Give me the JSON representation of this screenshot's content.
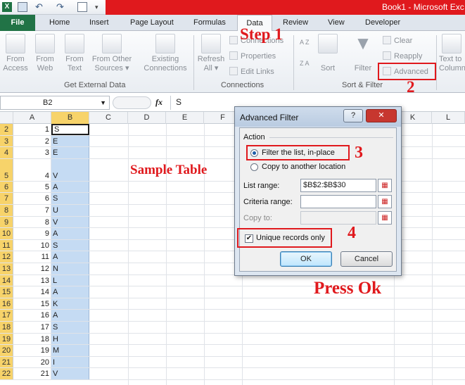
{
  "window": {
    "title": "Book1 - Microsoft Exc"
  },
  "tabs": [
    "File",
    "Home",
    "Insert",
    "Page Layout",
    "Formulas",
    "Data",
    "Review",
    "View",
    "Developer"
  ],
  "ribbon": {
    "get_external": {
      "label": "Get External Data",
      "buttons": [
        {
          "l1": "From",
          "l2": "Access"
        },
        {
          "l1": "From",
          "l2": "Web"
        },
        {
          "l1": "From",
          "l2": "Text"
        },
        {
          "l1": "From Other",
          "l2": "Sources ▾"
        },
        {
          "l1": "Existing",
          "l2": "Connections"
        }
      ]
    },
    "connections": {
      "label": "Connections",
      "refresh": {
        "l1": "Refresh",
        "l2": "All ▾"
      },
      "items": [
        "Connections",
        "Properties",
        "Edit Links"
      ]
    },
    "sort_filter": {
      "label": "Sort & Filter",
      "az": "A Z",
      "za": "Z A",
      "sort": "Sort",
      "filter": "Filter",
      "clear": "Clear",
      "reapply": "Reapply",
      "advanced": "Advanced"
    },
    "data_tools": {
      "l1": "Text to",
      "l2": "Column"
    }
  },
  "formula_bar": {
    "cell": "B2",
    "fx": "fx",
    "value": "S"
  },
  "columns": [
    "A",
    "B",
    "C",
    "D",
    "E",
    "F",
    "G",
    "H",
    "I",
    "J",
    "K",
    "L"
  ],
  "rows": [
    {
      "n": "2",
      "a": "1",
      "b": "S"
    },
    {
      "n": "3",
      "a": "2",
      "b": "E"
    },
    {
      "n": "4",
      "a": "3",
      "b": "E"
    },
    {
      "n": "5",
      "a": "4",
      "b": "V"
    },
    {
      "n": "6",
      "a": "5",
      "b": "A"
    },
    {
      "n": "7",
      "a": "6",
      "b": "S"
    },
    {
      "n": "8",
      "a": "7",
      "b": "U"
    },
    {
      "n": "9",
      "a": "8",
      "b": "V"
    },
    {
      "n": "10",
      "a": "9",
      "b": "A"
    },
    {
      "n": "11",
      "a": "10",
      "b": "S"
    },
    {
      "n": "12",
      "a": "11",
      "b": "A"
    },
    {
      "n": "13",
      "a": "12",
      "b": "N"
    },
    {
      "n": "14",
      "a": "13",
      "b": "L"
    },
    {
      "n": "15",
      "a": "14",
      "b": "A"
    },
    {
      "n": "16",
      "a": "15",
      "b": "K"
    },
    {
      "n": "17",
      "a": "16",
      "b": "A"
    },
    {
      "n": "18",
      "a": "17",
      "b": "S"
    },
    {
      "n": "19",
      "a": "18",
      "b": "H"
    },
    {
      "n": "20",
      "a": "19",
      "b": "M"
    },
    {
      "n": "21",
      "a": "20",
      "b": "I"
    },
    {
      "n": "22",
      "a": "21",
      "b": "V"
    }
  ],
  "dialog": {
    "title": "Advanced Filter",
    "help": "?",
    "close": "✕",
    "action_label": "Action",
    "option1": "Filter the list, in-place",
    "option2": "Copy to another location",
    "list_range_label": "List range:",
    "list_range_value": "$B$2:$B$30",
    "criteria_label": "Criteria range:",
    "copy_to_label": "Copy to:",
    "unique_label": "Unique records only",
    "ok": "OK",
    "cancel": "Cancel"
  },
  "annotations": {
    "step1": "Step 1",
    "n2": "2",
    "n3": "3",
    "n4": "4",
    "sample": "Sample Table",
    "press_ok": "Press Ok"
  },
  "colors": {
    "red": "#e0191d",
    "selection": "#c5dbf3",
    "header_sel": "#f7d36a"
  }
}
